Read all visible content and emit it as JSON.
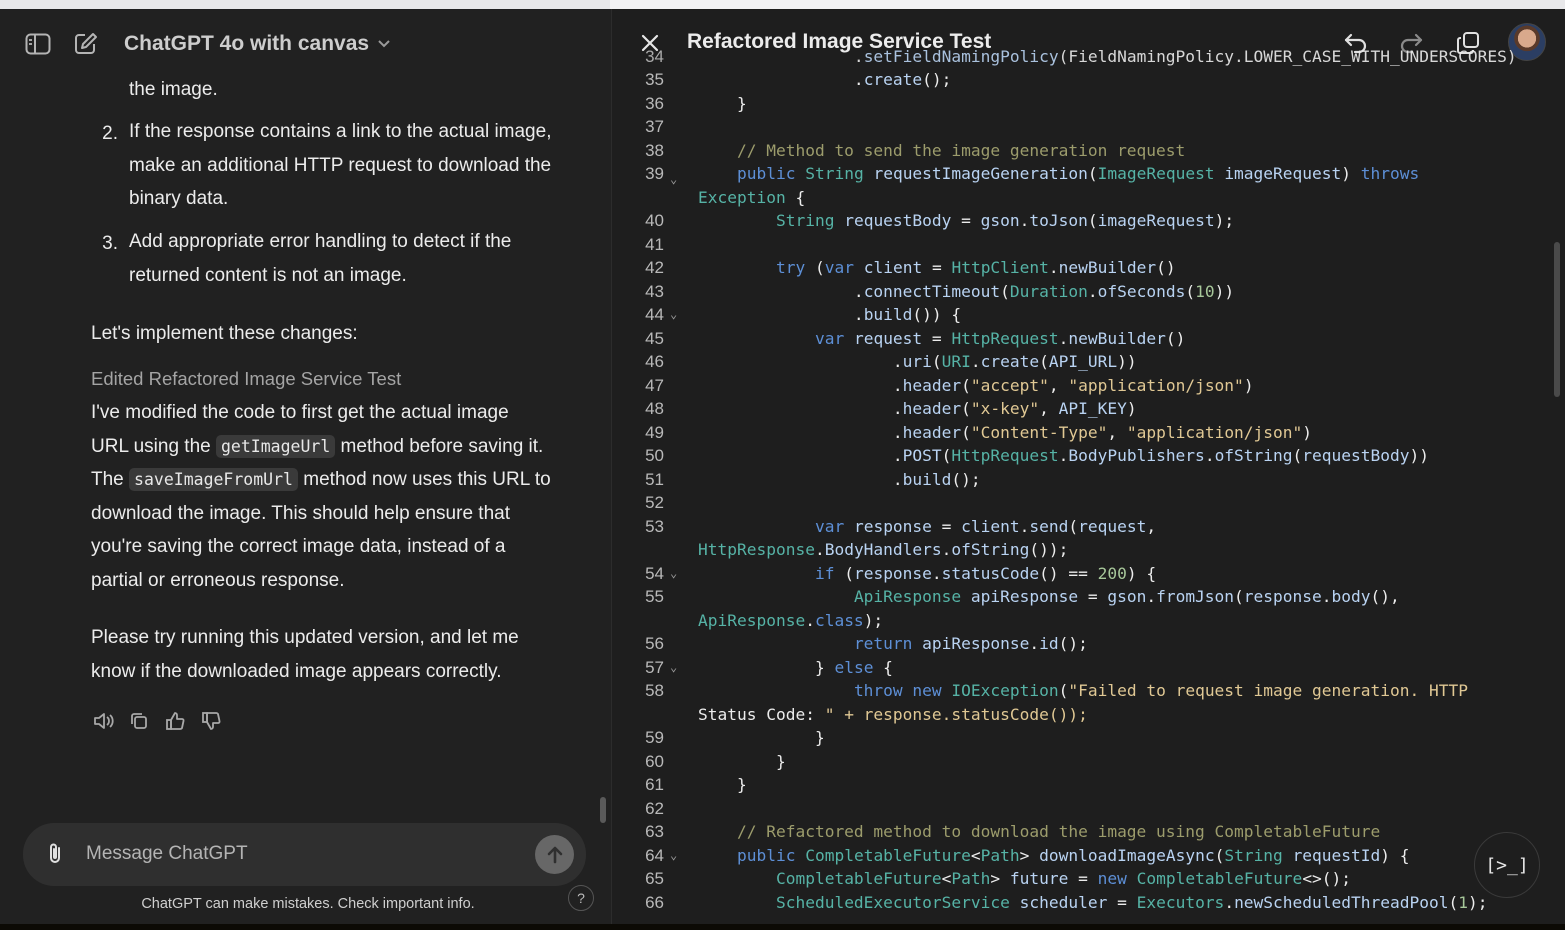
{
  "chat_header": {
    "model_name": "ChatGPT 4o with canvas"
  },
  "chat": {
    "p_top": "the image.",
    "list": [
      {
        "num": "2.",
        "lines": [
          "If the response contains a link to the actual image,",
          "make an additional HTTP request to download the",
          "binary data."
        ]
      },
      {
        "num": "3.",
        "lines": [
          "Add appropriate error handling to detect if the",
          "returned content is not an image."
        ]
      }
    ],
    "intro": "Let's implement these changes:",
    "edited_label": "Edited Refactored Image Service Test",
    "p2": {
      "l1": "I've modified the code to first get the actual image",
      "l2a": "URL using the",
      "code1": "getImageUrl",
      "l2b": "method before saving it.",
      "l3a": "The",
      "code2": "saveImageFromUrl",
      "l3b": "method now uses this URL to",
      "l4": "download the image. This should help ensure that",
      "l5": "you're saving the correct image data, instead of a",
      "l6": "partial or erroneous response."
    },
    "p3": {
      "l1": "Please try running this updated version, and let me",
      "l2": "know if the downloaded image appears correctly."
    }
  },
  "composer": {
    "placeholder": "Message ChatGPT"
  },
  "disclaimer": "ChatGPT can make mistakes. Check important info.",
  "help_label": "?",
  "canvas": {
    "title": "Refactored Image Service Test",
    "run_label": "[>_]"
  },
  "code_lines": [
    {
      "n": "35",
      "t": "                .create();"
    },
    {
      "n": "36",
      "t": "    }"
    },
    {
      "n": "37",
      "t": ""
    },
    {
      "n": "38",
      "t": "    // Method to send the image generation request"
    },
    {
      "n": "39",
      "t": "    public String requestImageGeneration(ImageRequest imageRequest) throws"
    },
    {
      "n": "",
      "t": "Exception {"
    },
    {
      "n": "40",
      "t": "        String requestBody = gson.toJson(imageRequest);"
    },
    {
      "n": "41",
      "t": ""
    },
    {
      "n": "42",
      "t": "        try (var client = HttpClient.newBuilder()"
    },
    {
      "n": "43",
      "t": "                .connectTimeout(Duration.ofSeconds(10))"
    },
    {
      "n": "44",
      "t": "                .build()) {"
    },
    {
      "n": "45",
      "t": "            var request = HttpRequest.newBuilder()"
    },
    {
      "n": "46",
      "t": "                    .uri(URI.create(API_URL))"
    },
    {
      "n": "47",
      "t": "                    .header(\"accept\", \"application/json\")"
    },
    {
      "n": "48",
      "t": "                    .header(\"x-key\", API_KEY)"
    },
    {
      "n": "49",
      "t": "                    .header(\"Content-Type\", \"application/json\")"
    },
    {
      "n": "50",
      "t": "                    .POST(HttpRequest.BodyPublishers.ofString(requestBody))"
    },
    {
      "n": "51",
      "t": "                    .build();"
    },
    {
      "n": "52",
      "t": ""
    },
    {
      "n": "53",
      "t": "            var response = client.send(request,"
    },
    {
      "n": "",
      "t": "HttpResponse.BodyHandlers.ofString());"
    },
    {
      "n": "54",
      "t": "            if (response.statusCode() == 200) {"
    },
    {
      "n": "55",
      "t": "                ApiResponse apiResponse = gson.fromJson(response.body(),"
    },
    {
      "n": "",
      "t": "ApiResponse.class);"
    },
    {
      "n": "56",
      "t": "                return apiResponse.id();"
    },
    {
      "n": "57",
      "t": "            } else {"
    },
    {
      "n": "58",
      "t": "                throw new IOException(\"Failed to request image generation. HTTP"
    },
    {
      "n": "",
      "t": "Status Code: \" + response.statusCode());"
    },
    {
      "n": "59",
      "t": "            }"
    },
    {
      "n": "60",
      "t": "        }"
    },
    {
      "n": "61",
      "t": "    }"
    },
    {
      "n": "62",
      "t": ""
    },
    {
      "n": "63",
      "t": "    // Refactored method to download the image using CompletableFuture"
    },
    {
      "n": "64",
      "t": "    public CompletableFuture<Path> downloadImageAsync(String requestId) {"
    },
    {
      "n": "65",
      "t": "        CompletableFuture<Path> future = new CompletableFuture<>();"
    },
    {
      "n": "66",
      "t": "        ScheduledExecutorService scheduler = Executors.newScheduledThreadPool(1);"
    }
  ],
  "code_top_partial": {
    "n": "34",
    "t": "                .setFieldNamingPolicy(FieldNamingPolicy.LOWER_CASE_WITH_UNDERSCORES)"
  },
  "fold_lines": [
    "39",
    "44",
    "54",
    "57",
    "64"
  ]
}
